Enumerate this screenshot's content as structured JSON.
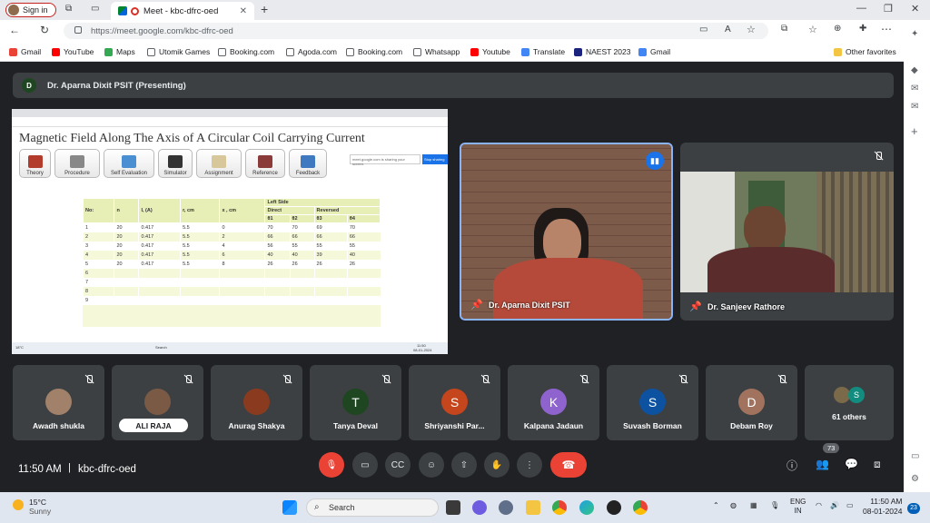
{
  "browser": {
    "signin_label": "Sign in",
    "tab_title": "Meet - kbc-dfrc-oed",
    "new_tab": "+",
    "url": "https://meet.google.com/kbc-dfrc-oed",
    "bookmarks": [
      {
        "label": "Gmail",
        "color": "#ea4335"
      },
      {
        "label": "YouTube",
        "color": "#ff0000"
      },
      {
        "label": "Maps",
        "color": "#34a853"
      },
      {
        "label": "Utomik Games",
        "color": "#5f6368"
      },
      {
        "label": "Booking.com",
        "color": "#5f6368"
      },
      {
        "label": "Agoda.com",
        "color": "#5f6368"
      },
      {
        "label": "Booking.com",
        "color": "#5f6368"
      },
      {
        "label": "Whatsapp",
        "color": "#5f6368"
      },
      {
        "label": "Youtube",
        "color": "#ff0000"
      },
      {
        "label": "Translate",
        "color": "#4285f4"
      },
      {
        "label": "NAEST 2023",
        "color": "#1a237e"
      },
      {
        "label": "Gmail",
        "color": "#4285f4"
      }
    ],
    "other_favorites": "Other favorites"
  },
  "meet": {
    "presenter_initial": "D",
    "presenter_label": "Dr. Aparna Dixit PSIT (Presenting)",
    "shared_screen": {
      "title": "Magnetic Field Along The Axis of A Circular Coil Carrying Current",
      "menu": [
        "Theory",
        "Procedure",
        "Self Evaluation",
        "Simulator",
        "Assignment",
        "Reference",
        "Feedback"
      ],
      "sharing_notice": "meet.google.com is sharing your screen.",
      "stop_sharing": "Stop sharing",
      "table": {
        "headers": [
          "No:",
          "n",
          "I, (A)",
          "r, cm",
          "x , cm",
          "Left Side"
        ],
        "sub_headers": [
          "Direct",
          "Reversed"
        ],
        "theta_headers": [
          "θ1",
          "θ2",
          "θ3",
          "θ4"
        ],
        "rows": [
          [
            "1",
            "20",
            "0.417",
            "5.5",
            "0",
            "70",
            "70",
            "69",
            "70"
          ],
          [
            "2",
            "20",
            "0.417",
            "5.5",
            "2",
            "66",
            "66",
            "66",
            "66"
          ],
          [
            "3",
            "20",
            "0.417",
            "5.5",
            "4",
            "56",
            "55",
            "55",
            "55"
          ],
          [
            "4",
            "20",
            "0.417",
            "5.5",
            "6",
            "40",
            "40",
            "39",
            "40"
          ],
          [
            "5",
            "20",
            "0.417",
            "5.5",
            "8",
            "26",
            "26",
            "26",
            "26"
          ],
          [
            "6",
            "",
            "",
            "",
            "",
            "",
            "",
            "",
            ""
          ],
          [
            "7",
            "",
            "",
            "",
            "",
            "",
            "",
            "",
            ""
          ],
          [
            "8",
            "",
            "",
            "",
            "",
            "",
            "",
            "",
            ""
          ],
          [
            "9",
            "",
            "",
            "",
            "",
            "",
            "",
            "",
            ""
          ]
        ]
      },
      "taskbar_weather": "18°C",
      "taskbar_search": "Search",
      "taskbar_time": "11:50",
      "taskbar_date": "08-01-2024"
    },
    "main_tiles": [
      {
        "name": "Dr. Aparna Dixit PSIT"
      },
      {
        "name": "Dr. Sanjeev Rathore"
      }
    ],
    "participants": [
      {
        "name": "Awadh shukla",
        "initial": "",
        "color": "#a1816a"
      },
      {
        "name": "ALI RAJA",
        "initial": "",
        "color": "#7b5a45"
      },
      {
        "name": "Anurag Shakya",
        "initial": "",
        "color": "#8a3b1f"
      },
      {
        "name": "Tanya Deval",
        "initial": "T",
        "color": "#1e4620"
      },
      {
        "name": "Shriyanshi Par...",
        "initial": "S",
        "color": "#c5451d"
      },
      {
        "name": "Kalpana Jadaun",
        "initial": "K",
        "color": "#8e63ce"
      },
      {
        "name": "Suvash Borman",
        "initial": "S",
        "color": "#0d52a1"
      },
      {
        "name": "Debam Roy",
        "initial": "D",
        "color": "#a1735e"
      }
    ],
    "others": {
      "label": "61 others",
      "initial": "S"
    },
    "time": "11:50 AM",
    "separator": "|",
    "meeting_code": "kbc-dfrc-oed",
    "participant_count": "73"
  },
  "taskbar": {
    "temp": "15°C",
    "condition": "Sunny",
    "search": "Search",
    "lang1": "ENG",
    "lang2": "IN",
    "time": "11:50 AM",
    "date": "08-01-2024",
    "notifications": "23"
  }
}
